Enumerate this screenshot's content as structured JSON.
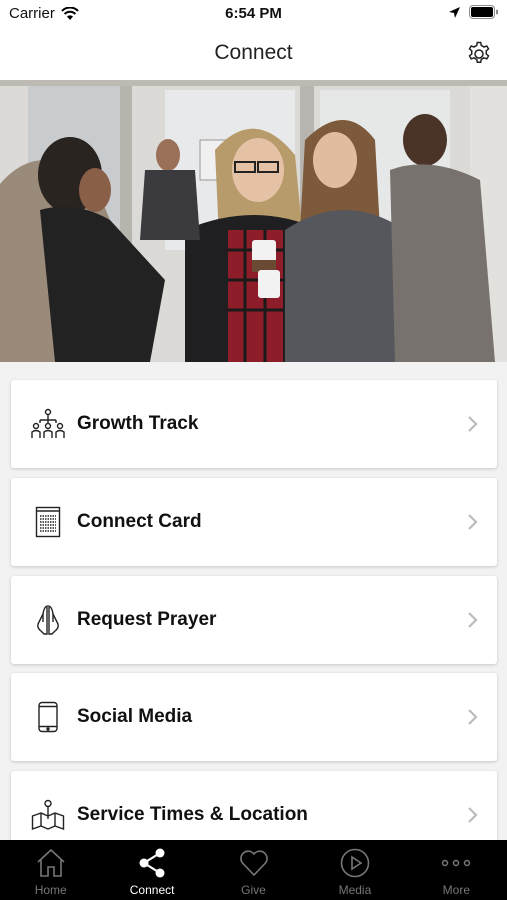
{
  "status_bar": {
    "carrier": "Carrier",
    "time": "6:54 PM"
  },
  "header": {
    "title": "Connect"
  },
  "menu": {
    "items": [
      {
        "label": "Growth Track",
        "icon": "people-network-icon"
      },
      {
        "label": "Connect Card",
        "icon": "document-icon"
      },
      {
        "label": "Request Prayer",
        "icon": "praying-hands-icon"
      },
      {
        "label": "Social Media",
        "icon": "phone-icon"
      },
      {
        "label": "Service Times & Location",
        "icon": "map-pin-icon"
      }
    ]
  },
  "tabbar": {
    "items": [
      {
        "label": "Home",
        "icon": "home-icon",
        "active": false
      },
      {
        "label": "Connect",
        "icon": "share-icon",
        "active": true
      },
      {
        "label": "Give",
        "icon": "heart-icon",
        "active": false
      },
      {
        "label": "Media",
        "icon": "play-icon",
        "active": false
      },
      {
        "label": "More",
        "icon": "more-dots-icon",
        "active": false
      }
    ]
  },
  "colors": {
    "tabbar_bg": "#000000",
    "active_tab": "#ffffff",
    "inactive_tab": "#777777",
    "card_bg": "#ffffff"
  }
}
